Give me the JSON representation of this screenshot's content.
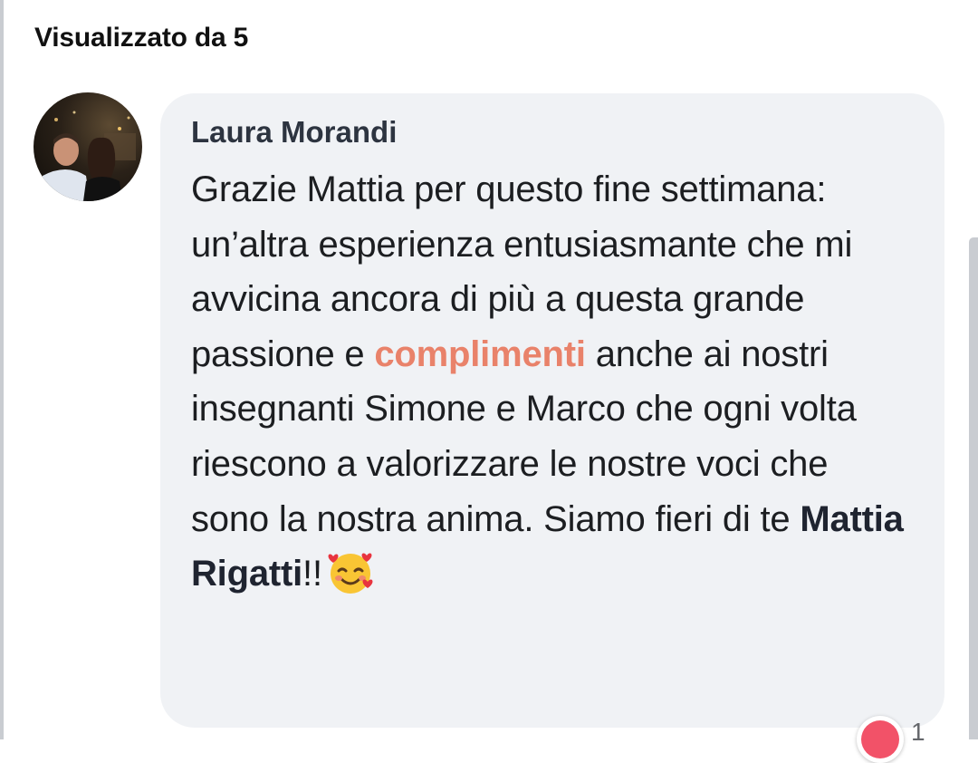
{
  "header": {
    "seen_by": "Visualizzato da 5"
  },
  "comment": {
    "author": "Laura Morandi",
    "text_part1": "Grazie Mattia per questo fine settimana: un’altra esperienza entusiasmante che mi avvicina ancora di più a questa grande passione e ",
    "highlight": "complimenti",
    "text_part2": " anche ai nostri insegnanti Simone e Marco che ogni volta riescono a valorizzare le nostre voci che sono la nostra anima. Siamo fieri di te ",
    "mention": "Mattia Rigatti",
    "text_part3": "!!",
    "emoji": "smiling-face-with-hearts",
    "highlight_color": "#e9826a"
  },
  "reactions": {
    "icon": "love-icon",
    "count": "1"
  }
}
